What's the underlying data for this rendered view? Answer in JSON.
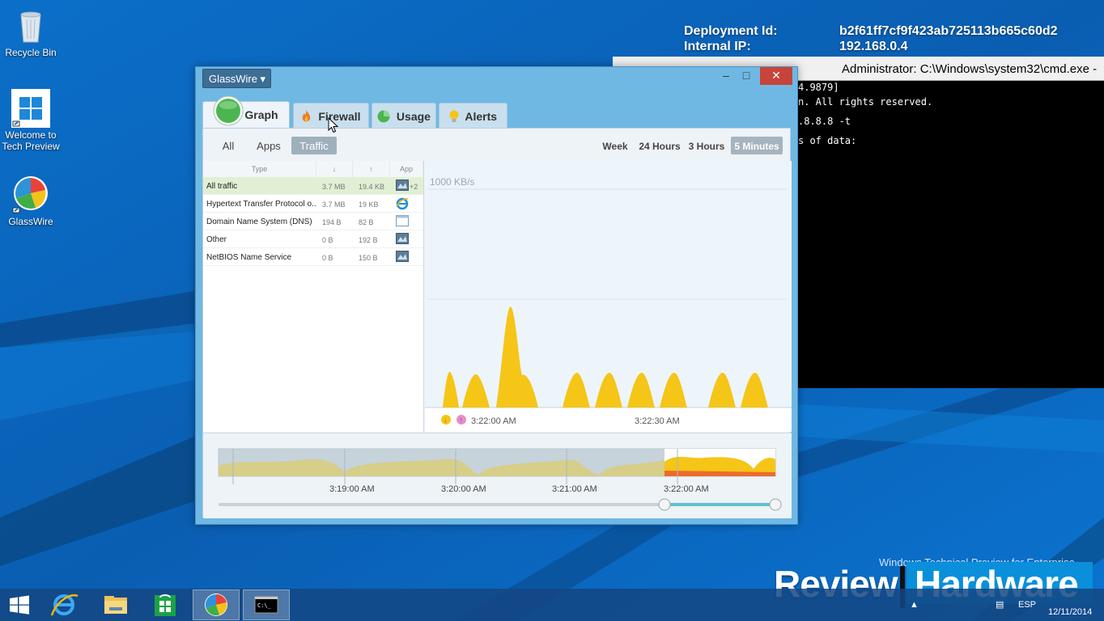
{
  "desktop": {
    "icons": [
      {
        "label": "Recycle Bin",
        "icon": "recycle-bin-icon"
      },
      {
        "label": "Welcome to Tech Preview",
        "icon": "windows-logo-icon"
      },
      {
        "label": "GlassWire",
        "icon": "glasswire-icon"
      }
    ],
    "info": {
      "deployment_label": "Deployment Id:",
      "deployment_value": "b2f61ff7cf9f423ab725113b665c60d2",
      "ip_label": "Internal IP:",
      "ip_value": "192.168.0.4"
    },
    "enterprise_text": "Windows Technical Preview for Enterprise"
  },
  "cmd": {
    "title": "Administrator: C:\\Windows\\system32\\cmd.exe -",
    "lines": [
      "4.9879]",
      "n. All rights reserved.",
      ".8.8.8 -t",
      "s of data:"
    ]
  },
  "glasswire": {
    "menu_label": "GlassWire ▾",
    "controls": {
      "minimize": "–",
      "maximize": "□",
      "close": "✕"
    },
    "tabs": [
      {
        "label": "Graph",
        "icon": "graph-icon"
      },
      {
        "label": "Firewall",
        "icon": "fire-icon"
      },
      {
        "label": "Usage",
        "icon": "usage-icon"
      },
      {
        "label": "Alerts",
        "icon": "alert-bulb-icon"
      }
    ],
    "filters": [
      "All",
      "Apps",
      "Traffic"
    ],
    "selected_filter": "Traffic",
    "timeframes": [
      "Week",
      "24 Hours",
      "3 Hours",
      "5 Minutes"
    ],
    "selected_timeframe": "5 Minutes",
    "table": {
      "headers": {
        "type": "Type",
        "down": "↓",
        "up": "↑",
        "app": "App"
      },
      "rows": [
        {
          "type": "All traffic",
          "down": "3.7 MB",
          "up": "19.4 KB",
          "app_extra": "+2"
        },
        {
          "type": "Hypertext Transfer Protocol o...",
          "down": "3.7 MB",
          "up": "19 KB",
          "app_extra": ""
        },
        {
          "type": "Domain Name System (DNS)",
          "down": "194 B",
          "up": "82 B",
          "app_extra": ""
        },
        {
          "type": "Other",
          "down": "0 B",
          "up": "192 B",
          "app_extra": ""
        },
        {
          "type": "NetBIOS Name Service",
          "down": "0 B",
          "up": "150 B",
          "app_extra": ""
        }
      ]
    },
    "graph": {
      "scale_label": "1000 KB/s",
      "time_labels": [
        "3:22:00 AM",
        "3:22:30 AM"
      ]
    },
    "timeline": {
      "time_labels": [
        "3:19:00 AM",
        "3:20:00 AM",
        "3:21:00 AM",
        "3:22:00 AM"
      ]
    },
    "colors": {
      "download": "#f5c518",
      "upload": "#e58ec6",
      "accent": "#6fb8e3"
    }
  },
  "taskbar": {
    "apps": [
      "start-button",
      "internet-explorer",
      "file-explorer",
      "store",
      "glasswire",
      "command-prompt"
    ],
    "language": "ESP",
    "date": "12/11/2014"
  },
  "watermark": {
    "left": "Review",
    "right": "Hardware"
  }
}
